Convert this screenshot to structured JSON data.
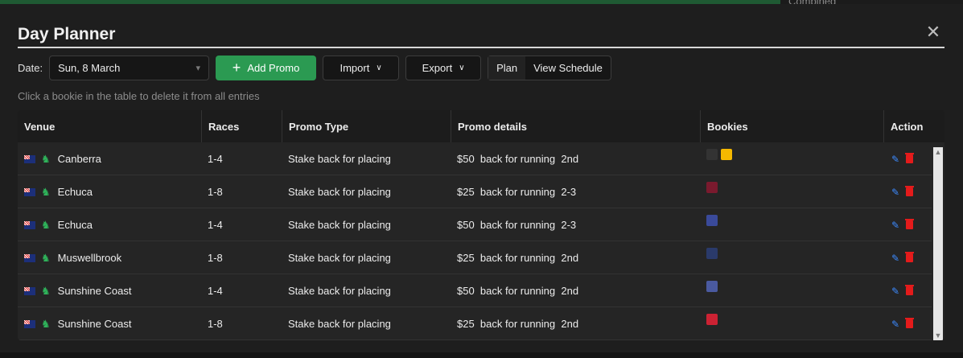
{
  "background": {
    "right_text": "Combined"
  },
  "dialog": {
    "title": "Day Planner",
    "close_label": "✕"
  },
  "toolbar": {
    "date_label": "Date:",
    "date_value": "Sun, 8 March",
    "add_label": "Add Promo",
    "import_label": "Import",
    "export_label": "Export",
    "plan_label": "Plan",
    "schedule_label": "View Schedule"
  },
  "hint": "Click a bookie in the table to delete it from all entries",
  "table": {
    "headers": [
      "Venue",
      "Races",
      "Promo Type",
      "Promo details",
      "Bookies",
      "Action"
    ],
    "rows": [
      {
        "venue": "Canberra",
        "races": "1-4",
        "type": "Stake back for placing",
        "details": "$50  back for running  2nd"
      },
      {
        "venue": "Echuca",
        "races": "1-8",
        "type": "Stake back for placing",
        "details": "$25  back for running  2-3"
      },
      {
        "venue": "Echuca",
        "races": "1-4",
        "type": "Stake back for placing",
        "details": "$50  back for running  2-3"
      },
      {
        "venue": "Muswellbrook",
        "races": "1-8",
        "type": "Stake back for placing",
        "details": "$25  back for running  2nd"
      },
      {
        "venue": "Sunshine Coast",
        "races": "1-4",
        "type": "Stake back for placing",
        "details": "$50  back for running  2nd"
      },
      {
        "venue": "Sunshine Coast",
        "races": "1-8",
        "type": "Stake back for placing",
        "details": "$25  back for running  2nd"
      }
    ]
  },
  "colors": {
    "accent": "#2b9a52",
    "edit": "#3d8bff",
    "delete": "#e41b1b"
  }
}
